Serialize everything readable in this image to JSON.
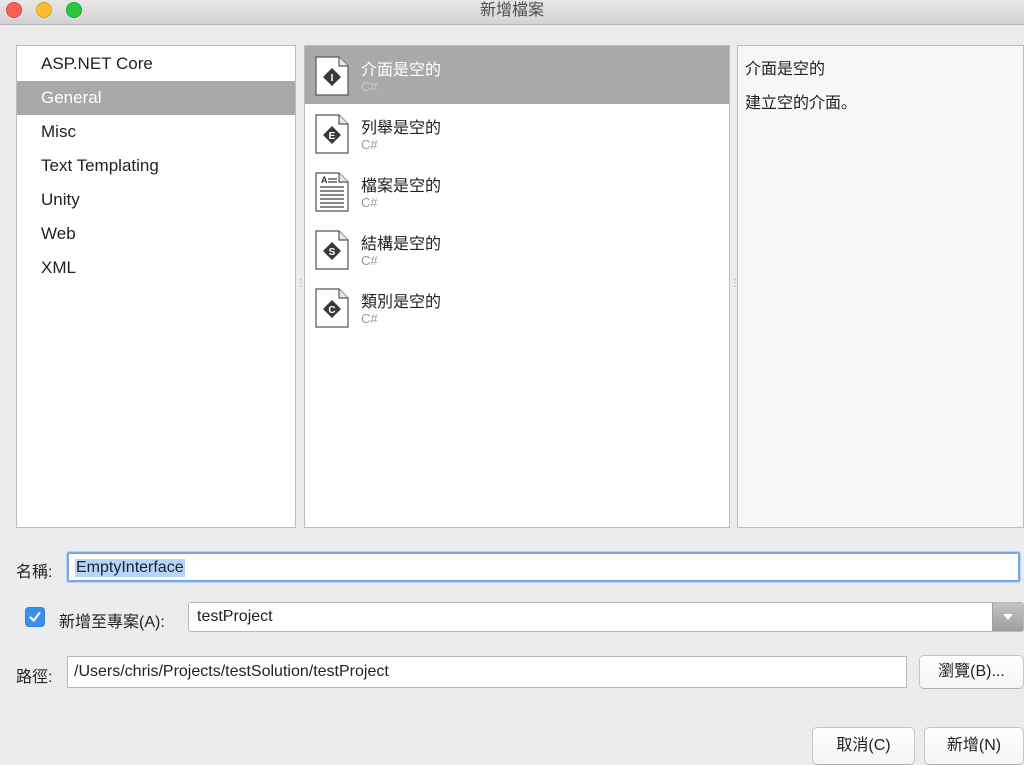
{
  "window": {
    "title": "新增檔案"
  },
  "categories": {
    "items": [
      {
        "label": "ASP.NET Core",
        "selected": false
      },
      {
        "label": "General",
        "selected": true
      },
      {
        "label": "Misc",
        "selected": false
      },
      {
        "label": "Text Templating",
        "selected": false
      },
      {
        "label": "Unity",
        "selected": false
      },
      {
        "label": "Web",
        "selected": false
      },
      {
        "label": "XML",
        "selected": false
      }
    ]
  },
  "templates": {
    "items": [
      {
        "name": "介面是空的",
        "lang": "C#",
        "icon": "interface-icon",
        "glyph": "I",
        "selected": true
      },
      {
        "name": "列舉是空的",
        "lang": "C#",
        "icon": "enum-icon",
        "glyph": "E",
        "selected": false
      },
      {
        "name": "檔案是空的",
        "lang": "C#",
        "icon": "file-icon",
        "glyph": "A",
        "selected": false
      },
      {
        "name": "結構是空的",
        "lang": "C#",
        "icon": "struct-icon",
        "glyph": "S",
        "selected": false
      },
      {
        "name": "類別是空的",
        "lang": "C#",
        "icon": "class-icon",
        "glyph": "C",
        "selected": false
      }
    ]
  },
  "description": {
    "title": "介面是空的",
    "text": "建立空的介面。"
  },
  "form": {
    "name_label": "名稱:",
    "name_value": "EmptyInterface",
    "add_to_project_label": "新增至專案(A):",
    "add_to_project_checked": true,
    "project_value": "testProject",
    "path_label": "路徑:",
    "path_value": "/Users/chris/Projects/testSolution/testProject",
    "browse_label": "瀏覽(B)..."
  },
  "buttons": {
    "cancel_label": "取消(C)",
    "add_label": "新增(N)"
  },
  "colors": {
    "selection": "#a9a9a9",
    "checkbox": "#3b8ef0",
    "focus_ring": "#7aa7e6"
  }
}
